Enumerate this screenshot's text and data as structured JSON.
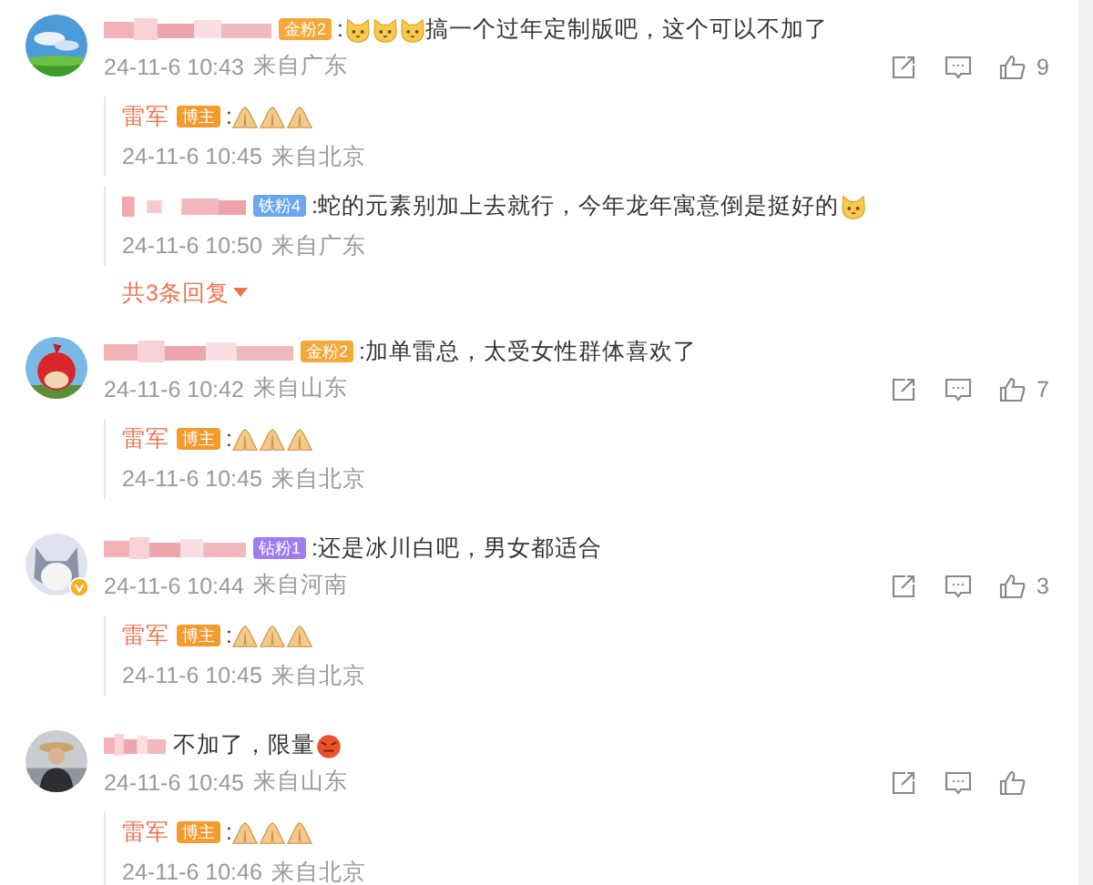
{
  "comments": [
    {
      "avatar": {
        "kind": "landscape"
      },
      "verified": false,
      "badge": {
        "text": "金粉2",
        "color": "#f5a83a"
      },
      "content": [
        {
          "kind": "text",
          "text": ":"
        },
        {
          "kind": "cat"
        },
        {
          "kind": "cat"
        },
        {
          "kind": "cat"
        },
        {
          "kind": "text",
          "text": "搞一个过年定制版吧，这个可以不加了"
        }
      ],
      "time": "24-11-6 10:43",
      "location": "来自广东",
      "likes": "9",
      "replies": [
        {
          "name": "雷军",
          "badge": {
            "text": "博主",
            "color": "#f59b2e"
          },
          "content": [
            {
              "kind": "text",
              "text": ":"
            },
            {
              "kind": "hands"
            },
            {
              "kind": "hands"
            },
            {
              "kind": "hands"
            }
          ],
          "time": "24-11-6 10:45",
          "location": "来自北京"
        },
        {
          "badge": {
            "text": "铁粉4",
            "color": "#6da6ee"
          },
          "content": [
            {
              "kind": "text",
              "text": ":蛇的元素别加上去就行，今年龙年寓意倒是挺好的"
            },
            {
              "kind": "cat"
            }
          ],
          "time": "24-11-6 10:50",
          "location": "来自广东"
        }
      ],
      "more": "共3条回复"
    },
    {
      "avatar": {
        "kind": "bird"
      },
      "verified": false,
      "badge": {
        "text": "金粉2",
        "color": "#f5a83a"
      },
      "content": [
        {
          "kind": "text",
          "text": ":加单雷总，太受女性群体喜欢了"
        }
      ],
      "time": "24-11-6 10:42",
      "location": "来自山东",
      "likes": "7",
      "replies": [
        {
          "name": "雷军",
          "badge": {
            "text": "博主",
            "color": "#f59b2e"
          },
          "content": [
            {
              "kind": "text",
              "text": ":"
            },
            {
              "kind": "hands"
            },
            {
              "kind": "hands"
            },
            {
              "kind": "hands"
            }
          ],
          "time": "24-11-6 10:45",
          "location": "来自北京"
        }
      ]
    },
    {
      "avatar": {
        "kind": "cat"
      },
      "verified": true,
      "badge": {
        "text": "钻粉1",
        "color": "#a07cf0"
      },
      "content": [
        {
          "kind": "text",
          "text": ":还是冰川白吧，男女都适合"
        }
      ],
      "time": "24-11-6 10:44",
      "location": "来自河南",
      "likes": "3",
      "replies": [
        {
          "name": "雷军",
          "badge": {
            "text": "博主",
            "color": "#f59b2e"
          },
          "content": [
            {
              "kind": "text",
              "text": ":"
            },
            {
              "kind": "hands"
            },
            {
              "kind": "hands"
            },
            {
              "kind": "hands"
            }
          ],
          "time": "24-11-6 10:45",
          "location": "来自北京"
        }
      ]
    },
    {
      "avatar": {
        "kind": "person"
      },
      "verified": false,
      "content": [
        {
          "kind": "text",
          "text": "不加了，限量"
        },
        {
          "kind": "angry"
        }
      ],
      "time": "24-11-6 10:45",
      "location": "来自山东",
      "replies": [
        {
          "name": "雷军",
          "badge": {
            "text": "博主",
            "color": "#f59b2e"
          },
          "content": [
            {
              "kind": "text",
              "text": ":"
            },
            {
              "kind": "hands"
            },
            {
              "kind": "hands"
            },
            {
              "kind": "hands"
            }
          ],
          "time": "24-11-6 10:46",
          "location": "来自北京"
        }
      ]
    }
  ]
}
